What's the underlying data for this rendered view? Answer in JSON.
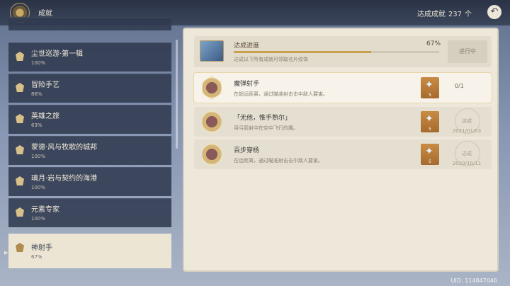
{
  "header": {
    "title": "成就",
    "count_label": "达成成就",
    "count_value": "237",
    "count_unit": "个"
  },
  "sidebar": {
    "items": [
      {
        "name": "尘世巡游·第一辑",
        "percent": "100%"
      },
      {
        "name": "冒险手艺",
        "percent": "86%"
      },
      {
        "name": "英雄之旅",
        "percent": "63%"
      },
      {
        "name": "蒙德·风与牧歌的城邦",
        "percent": "100%"
      },
      {
        "name": "璃月·岩与契约的海港",
        "percent": "100%"
      },
      {
        "name": "元素专家",
        "percent": "100%"
      },
      {
        "name": "神射手",
        "percent": "67%"
      }
    ],
    "active_index": 6
  },
  "progress": {
    "title": "达成进度",
    "percent": "67%",
    "fill_fraction": 0.67,
    "description": "达成以下所有成就可领取名片纹饰",
    "status": "进行中"
  },
  "achievements": [
    {
      "name": "魔弹射手",
      "description": "在超远距离，通过瞄准射击击中敌人要害。",
      "reward": "5",
      "progress": "0/1",
      "done_label": "",
      "date": ""
    },
    {
      "name": "「无他，惟手熟尔」",
      "description": "用弓箭射中在空中飞行的鹰。",
      "reward": "5",
      "progress": "",
      "done_label": "达成",
      "date": "2021/01/03"
    },
    {
      "name": "百步穿杨",
      "description": "在远距离，通过瞄准射击击中敌人要害。",
      "reward": "5",
      "progress": "",
      "done_label": "达成",
      "date": "2020/10/11"
    }
  ],
  "uid": "UID: 114847046",
  "icons": {
    "back": "back-arrow-icon",
    "emblem": "achievement-emblem-icon"
  }
}
